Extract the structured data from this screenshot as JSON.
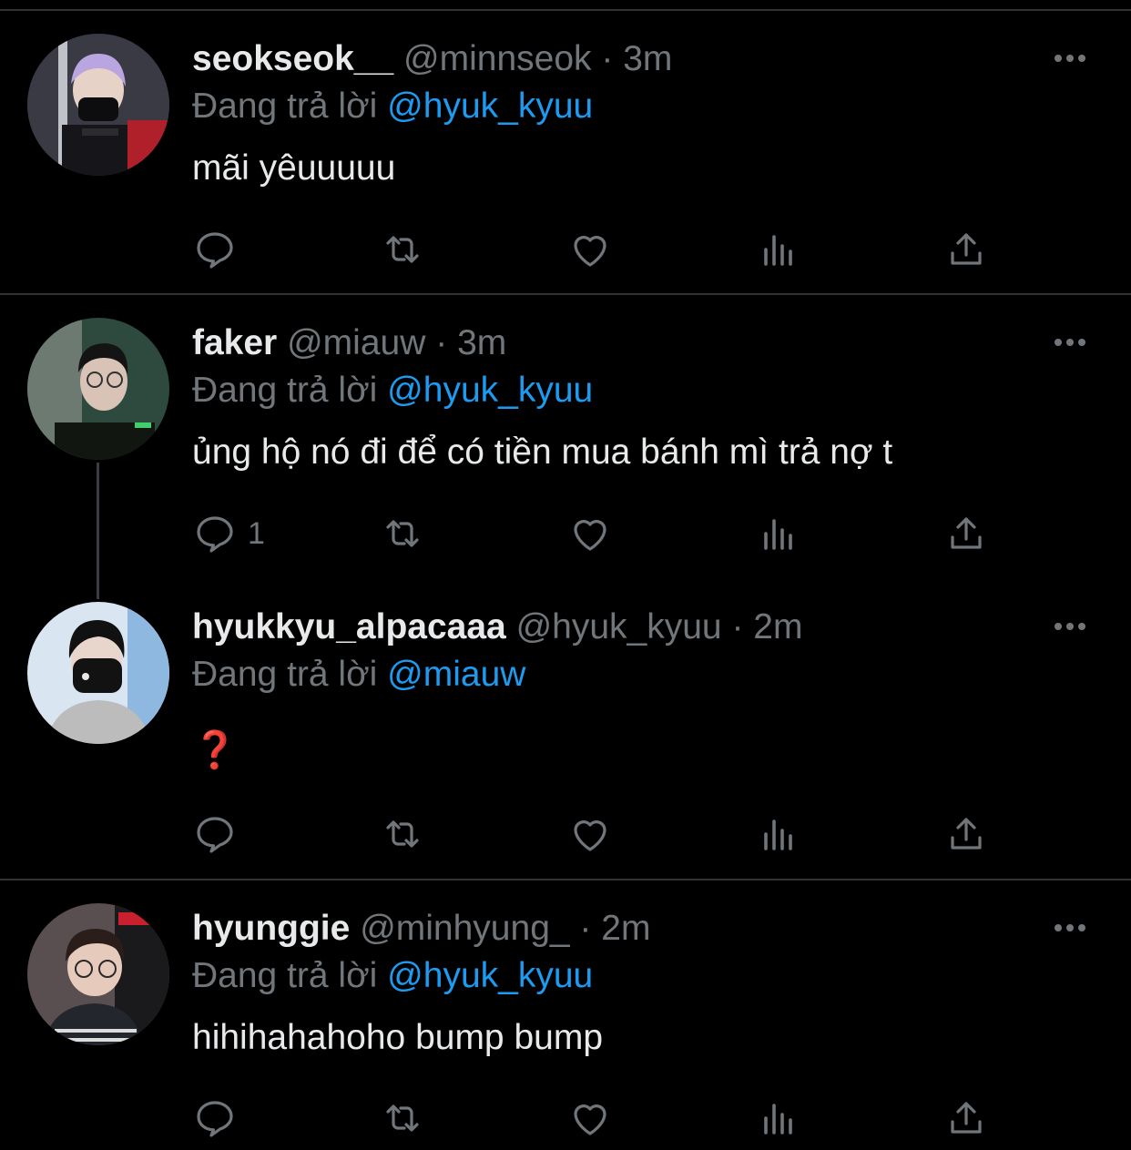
{
  "tweets": [
    {
      "display_name": "seokseok__",
      "handle": "@minnseok",
      "separator": "·",
      "time": "3m",
      "reply_prefix": "Đang trả lời",
      "reply_to": "@hyuk_kyuu",
      "text": "mãi yêuuuuu",
      "reply_count": ""
    },
    {
      "display_name": "faker",
      "handle": "@miauw",
      "separator": "·",
      "time": "3m",
      "reply_prefix": "Đang trả lời",
      "reply_to": "@hyuk_kyuu",
      "text": "ủng hộ nó đi để có tiền mua bánh mì trả nợ t",
      "reply_count": "1"
    },
    {
      "display_name": "hyukkyu_alpacaaa",
      "handle": "@hyuk_kyuu",
      "separator": "·",
      "time": "2m",
      "reply_prefix": "Đang trả lời",
      "reply_to": "@miauw",
      "text": "❓",
      "reply_count": ""
    },
    {
      "display_name": "hyunggie",
      "handle": "@minhyung_",
      "separator": "·",
      "time": "2m",
      "reply_prefix": "Đang trả lời",
      "reply_to": "@hyuk_kyuu",
      "text": "hihihahahoho bump bump",
      "reply_count": ""
    }
  ],
  "icons": {
    "reply": "reply-icon",
    "retweet": "retweet-icon",
    "like": "like-icon",
    "views": "views-icon",
    "share": "share-icon",
    "more": "more-icon"
  },
  "colors": {
    "background": "#000000",
    "text": "#e7e9ea",
    "muted": "#71767b",
    "mention": "#1d9bf0",
    "divider": "#2f3336",
    "question_mark": "#d0021b"
  }
}
